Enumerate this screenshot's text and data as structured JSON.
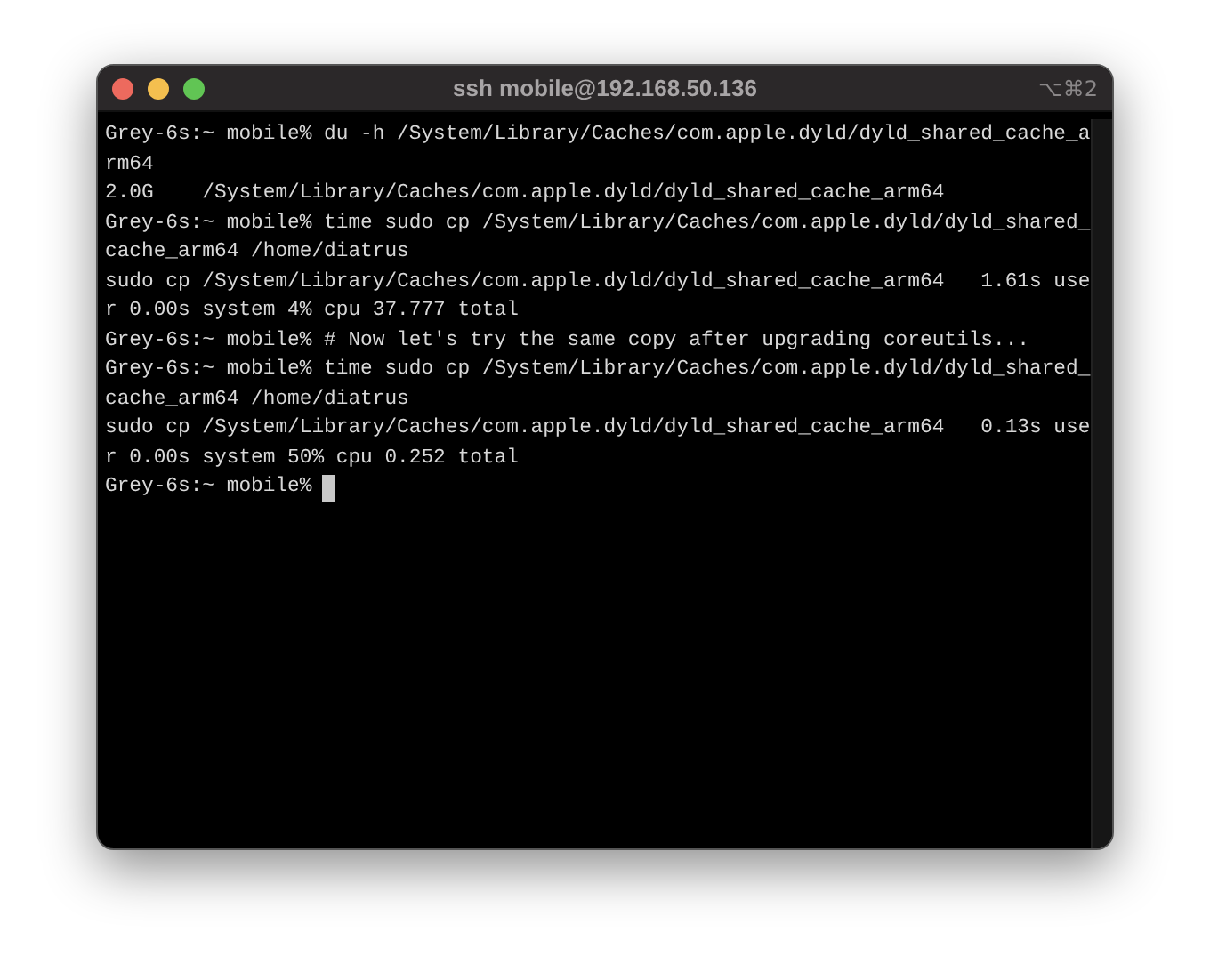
{
  "window": {
    "title": "ssh mobile@192.168.50.136",
    "shortcut": "⌥⌘2"
  },
  "terminal": {
    "lines": [
      "Grey-6s:~ mobile% du -h /System/Library/Caches/com.apple.dyld/dyld_shared_cache_a",
      "rm64",
      "2.0G    /System/Library/Caches/com.apple.dyld/dyld_shared_cache_arm64",
      "Grey-6s:~ mobile% time sudo cp /System/Library/Caches/com.apple.dyld/dyld_shared_",
      "cache_arm64 /home/diatrus",
      "sudo cp /System/Library/Caches/com.apple.dyld/dyld_shared_cache_arm64   1.61s use",
      "r 0.00s system 4% cpu 37.777 total",
      "Grey-6s:~ mobile% # Now let's try the same copy after upgrading coreutils...",
      "Grey-6s:~ mobile% time sudo cp /System/Library/Caches/com.apple.dyld/dyld_shared_",
      "cache_arm64 /home/diatrus",
      "sudo cp /System/Library/Caches/com.apple.dyld/dyld_shared_cache_arm64   0.13s use",
      "r 0.00s system 50% cpu 0.252 total"
    ],
    "prompt": "Grey-6s:~ mobile%"
  }
}
